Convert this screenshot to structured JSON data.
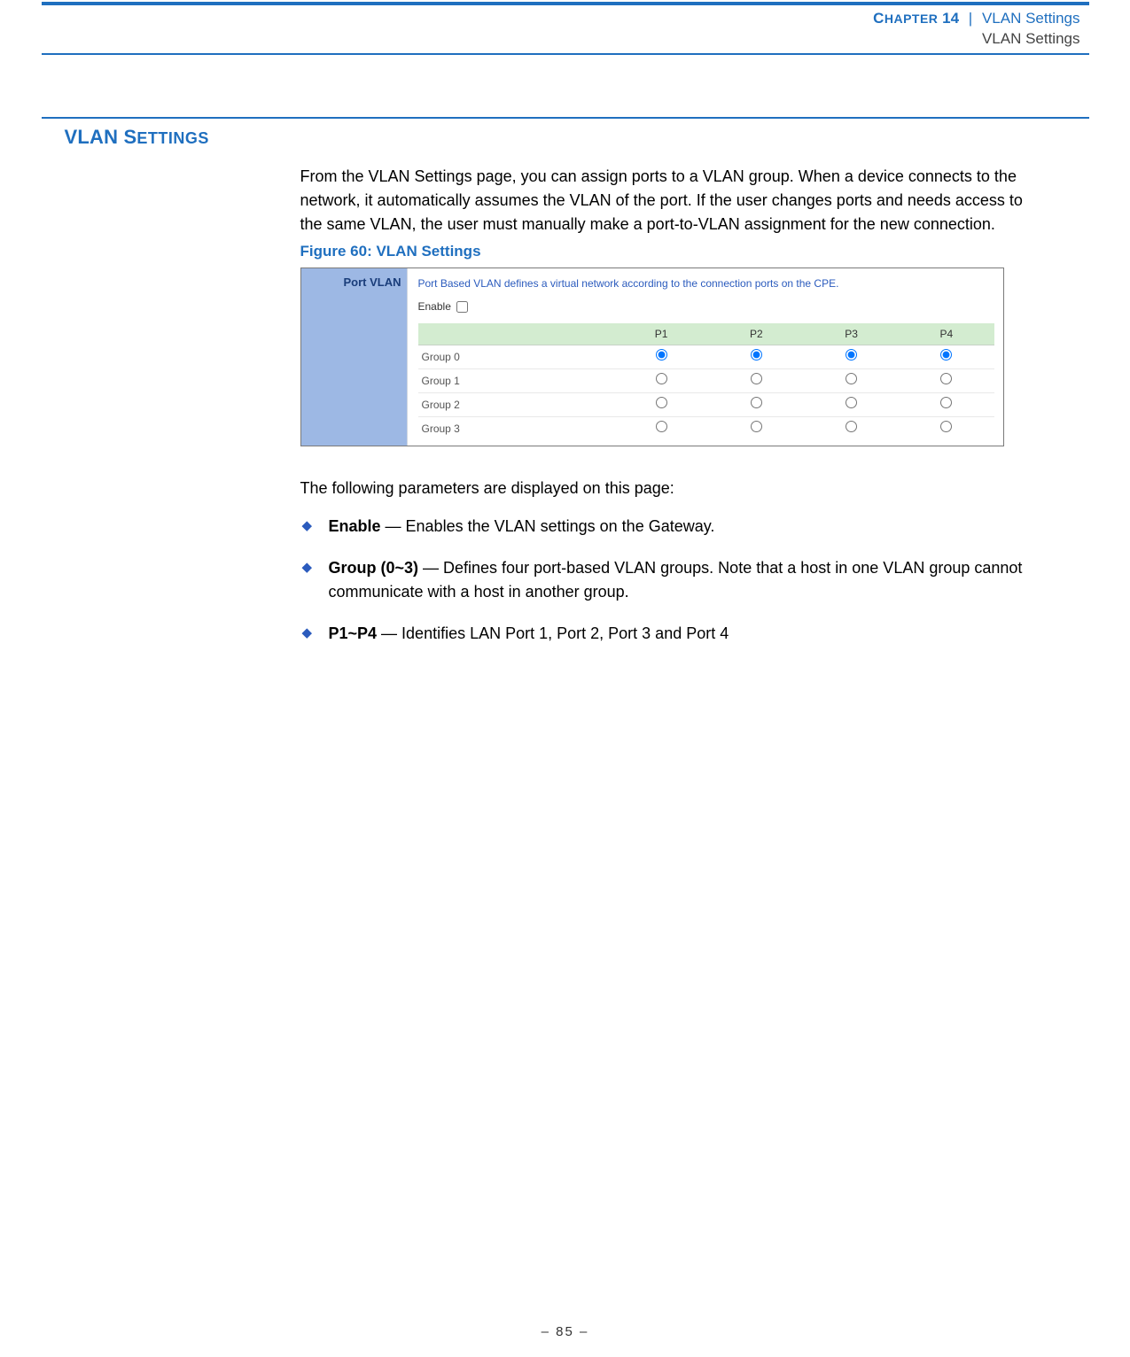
{
  "header": {
    "chapter_label_1": "C",
    "chapter_label_2": "HAPTER",
    "chapter_num": " 14",
    "sep": "|",
    "title": "VLAN Settings",
    "subtitle": "VLAN Settings"
  },
  "section": {
    "heading_initial": "VLAN S",
    "heading_rest": "ETTINGS"
  },
  "intro": "From the VLAN Settings page, you can assign ports to a VLAN group. When a device connects to the network, it automatically assumes the VLAN of the port. If the user changes ports and needs access to the same VLAN, the user must manually make a port-to-VLAN assignment for the new connection.",
  "figure": {
    "caption": "Figure 60:  VLAN Settings",
    "side_title": "Port VLAN",
    "description": "Port Based VLAN defines a virtual network according to the connection ports on the CPE.",
    "enable_label": "Enable",
    "enable_checked": false,
    "columns": [
      "",
      "P1",
      "P2",
      "P3",
      "P4"
    ],
    "rows": [
      {
        "label": "Group 0",
        "selected": [
          true,
          true,
          true,
          true
        ]
      },
      {
        "label": "Group 1",
        "selected": [
          false,
          false,
          false,
          false
        ]
      },
      {
        "label": "Group 2",
        "selected": [
          false,
          false,
          false,
          false
        ]
      },
      {
        "label": "Group 3",
        "selected": [
          false,
          false,
          false,
          false
        ]
      }
    ]
  },
  "params_intro": "The following parameters are displayed on this page:",
  "bullets": [
    {
      "term": "Enable",
      "desc": " — Enables the VLAN settings on the Gateway."
    },
    {
      "term": "Group (0~3)",
      "desc": " — Defines four port-based VLAN groups. Note that a host in one VLAN group cannot communicate with a host in another group."
    },
    {
      "term": "P1~P4",
      "desc": " — Identifies LAN Port 1, Port 2, Port 3 and Port 4"
    }
  ],
  "footer": "–  85  –"
}
